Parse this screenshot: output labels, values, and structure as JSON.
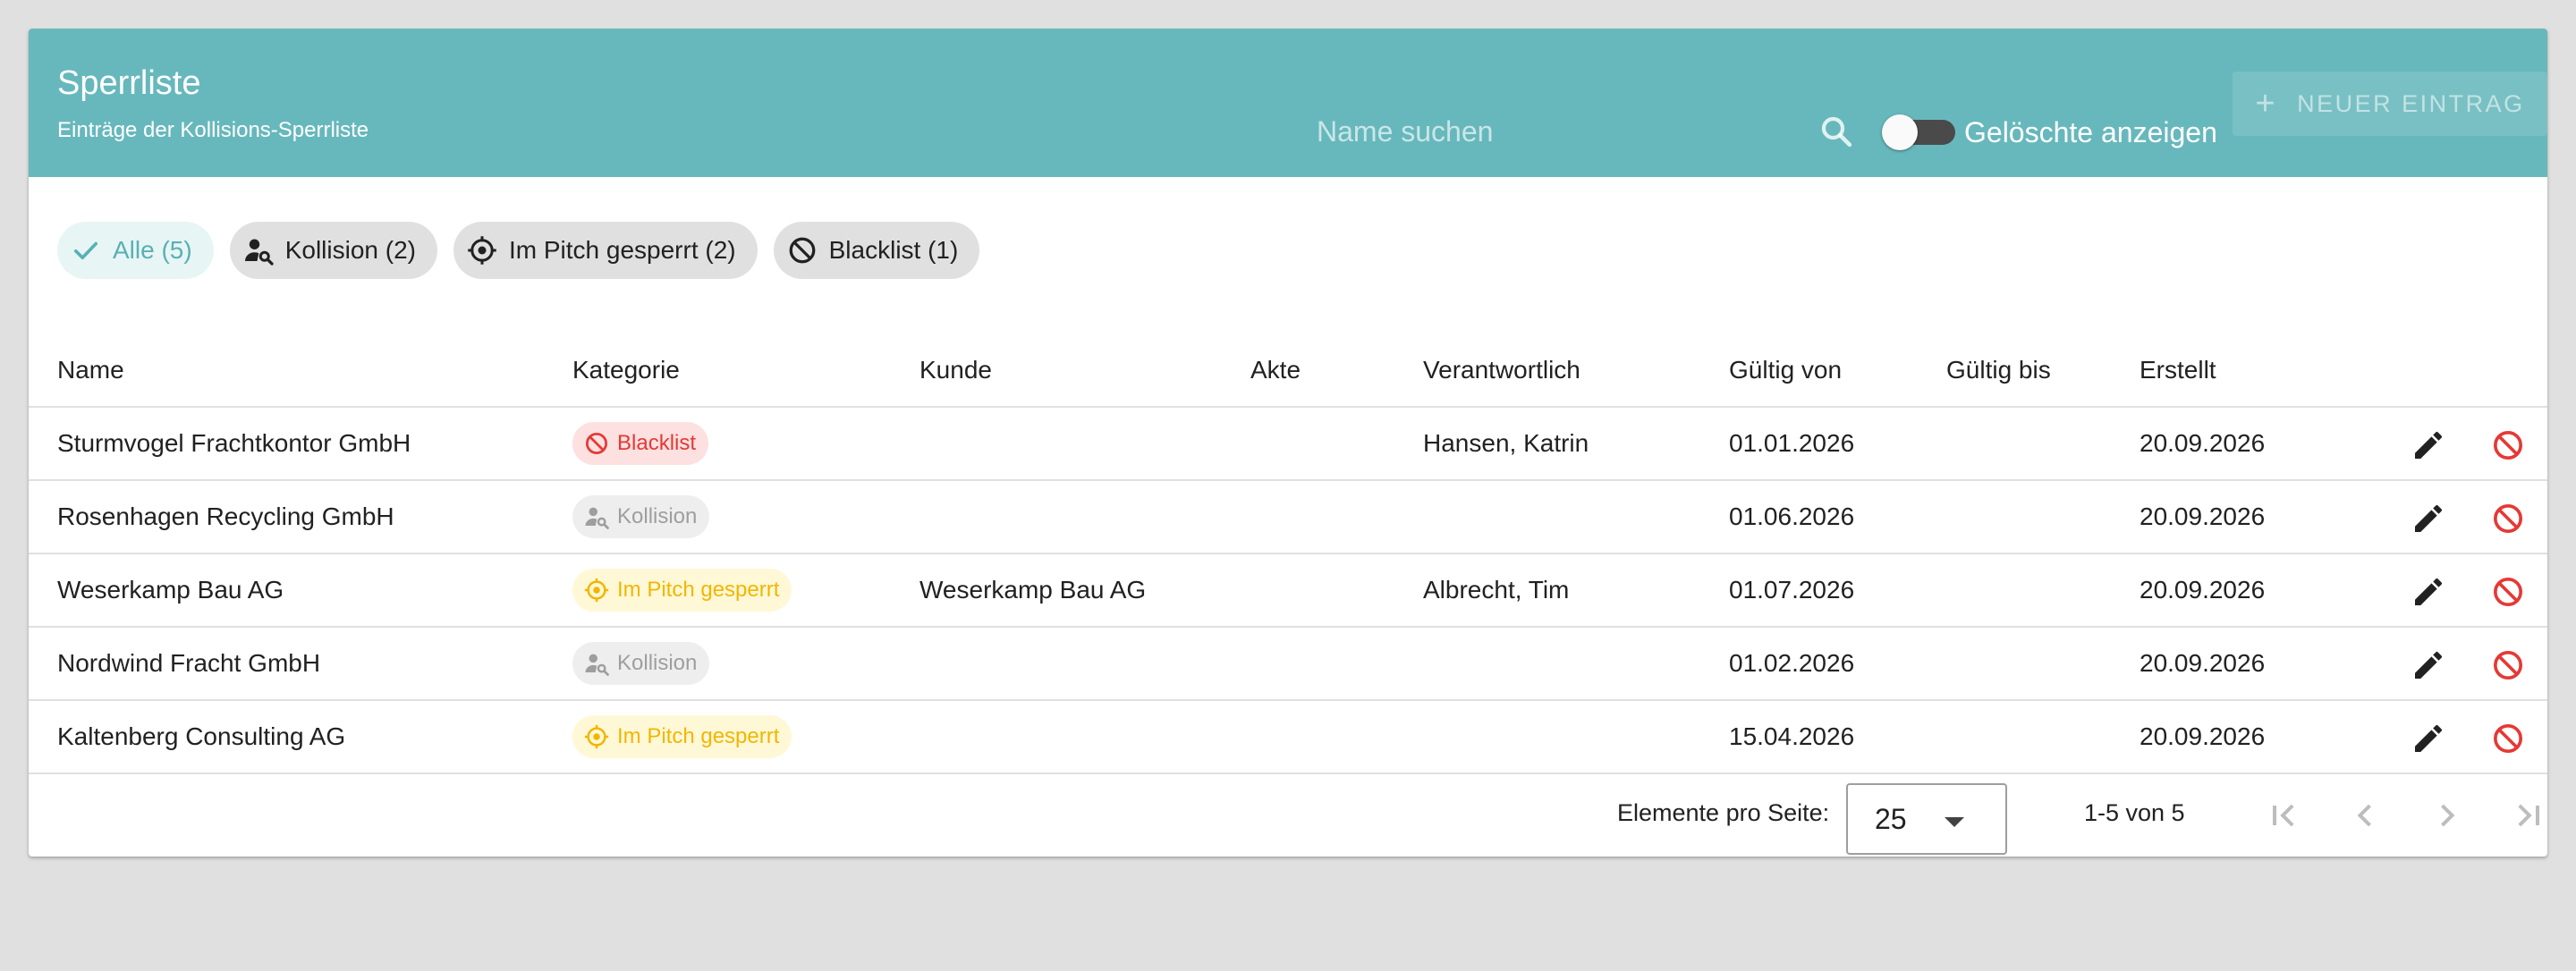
{
  "header": {
    "title": "Sperrliste",
    "subtitle": "Einträge der Kollisions-Sperrliste",
    "search_placeholder": "Name suchen",
    "toggle_label": "Gelöschte anzeigen",
    "new_button_label": "NEUER EINTRAG"
  },
  "filters": [
    {
      "label": "Alle (5)",
      "icon": "check-icon"
    },
    {
      "label": "Kollision (2)",
      "icon": "person-search-icon"
    },
    {
      "label": "Im Pitch gesperrt (2)",
      "icon": "crosshair-icon"
    },
    {
      "label": "Blacklist (1)",
      "icon": "block-icon"
    }
  ],
  "table": {
    "columns": [
      "Name",
      "Kategorie",
      "Kunde",
      "Akte",
      "Verantwortlich",
      "Gültig von",
      "Gültig bis",
      "Erstellt"
    ],
    "rows": [
      {
        "name": "Sturmvogel Frachtkontor GmbH",
        "kategorie": "Blacklist",
        "kunde": "",
        "akte": "",
        "verantwortlich": "Hansen, Katrin",
        "gueltig_von": "01.01.2026",
        "gueltig_bis": "",
        "erstellt": "20.09.2026"
      },
      {
        "name": "Rosenhagen Recycling GmbH",
        "kategorie": "Kollision",
        "kunde": "",
        "akte": "",
        "verantwortlich": "",
        "gueltig_von": "01.06.2026",
        "gueltig_bis": "",
        "erstellt": "20.09.2026"
      },
      {
        "name": "Weserkamp Bau AG",
        "kategorie": "Im Pitch gesperrt",
        "kunde": "Weserkamp Bau AG",
        "akte": "",
        "verantwortlich": "Albrecht, Tim",
        "gueltig_von": "01.07.2026",
        "gueltig_bis": "",
        "erstellt": "20.09.2026"
      },
      {
        "name": "Nordwind Fracht GmbH",
        "kategorie": "Kollision",
        "kunde": "",
        "akte": "",
        "verantwortlich": "",
        "gueltig_von": "01.02.2026",
        "gueltig_bis": "",
        "erstellt": "20.09.2026"
      },
      {
        "name": "Kaltenberg Consulting AG",
        "kategorie": "Im Pitch gesperrt",
        "kunde": "",
        "akte": "",
        "verantwortlich": "",
        "gueltig_von": "15.04.2026",
        "gueltig_bis": "",
        "erstellt": "20.09.2026"
      }
    ]
  },
  "paginator": {
    "per_page_label": "Elemente pro Seite:",
    "per_page_value": "25",
    "range_label": "1-5 von 5"
  },
  "colors": {
    "header": "#67b8bc",
    "accent": "#58b0b4",
    "blacklist": "#e53935",
    "pitch": "#f2b600",
    "kollision": "#9e9e9e"
  }
}
